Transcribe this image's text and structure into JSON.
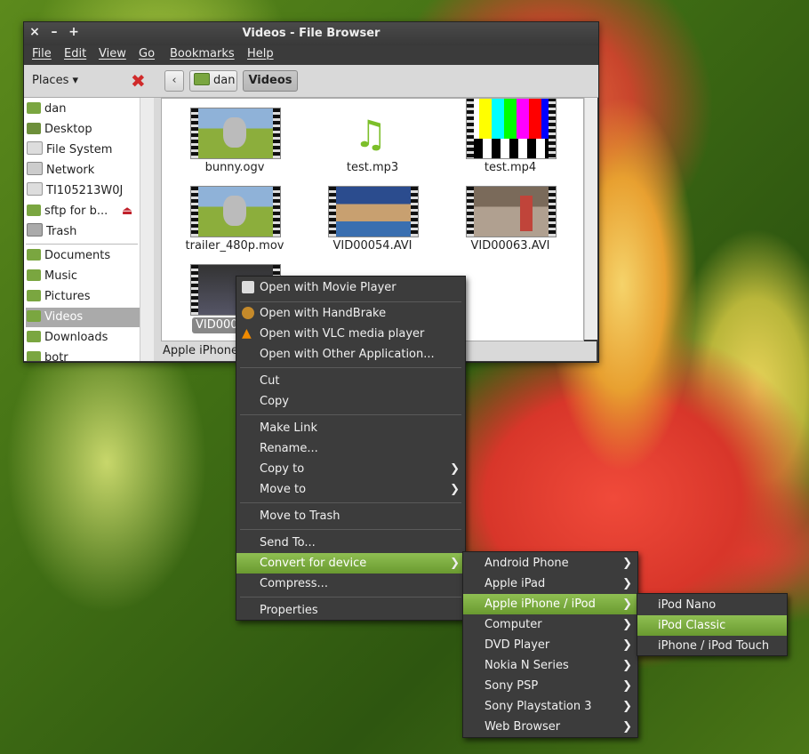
{
  "window": {
    "title": "Videos - File Browser",
    "controls": {
      "close": "×",
      "minimize": "–",
      "maximize": "+"
    }
  },
  "menubar": {
    "items": [
      "File",
      "Edit",
      "View",
      "Go",
      "Bookmarks",
      "Help"
    ]
  },
  "toolbar": {
    "places_label": "Places",
    "back": "‹",
    "breadcrumbs": [
      "dan",
      "Videos"
    ]
  },
  "sidebar": {
    "items": [
      "dan",
      "Desktop",
      "File System",
      "Network",
      "TI105213W0J",
      "sftp for b...",
      "Trash"
    ],
    "bookmarks": [
      "Documents",
      "Music",
      "Pictures",
      "Videos",
      "Downloads",
      "botr"
    ],
    "selected": "Videos",
    "eject_icon": "eject-icon"
  },
  "files": [
    {
      "name": "bunny.ogv",
      "kind": "video"
    },
    {
      "name": "test.mp3",
      "kind": "audio"
    },
    {
      "name": "test.mp4",
      "kind": "video"
    },
    {
      "name": "trailer_480p.mov",
      "kind": "video"
    },
    {
      "name": "VID00054.AVI",
      "kind": "video"
    },
    {
      "name": "VID00063.AVI",
      "kind": "video"
    },
    {
      "name": "VID000",
      "kind": "video",
      "selected": true
    }
  ],
  "statusbar": {
    "text": "Apple iPhone"
  },
  "context_menu": {
    "items": [
      {
        "label": "Open with Movie Player"
      },
      {
        "label": "Open with HandBrake"
      },
      {
        "label": "Open with VLC media player"
      },
      {
        "label": "Open with Other Application..."
      },
      {
        "label": "Cut"
      },
      {
        "label": "Copy"
      },
      {
        "label": "Make Link"
      },
      {
        "label": "Rename..."
      },
      {
        "label": "Copy to"
      },
      {
        "label": "Move to"
      },
      {
        "label": "Move to Trash"
      },
      {
        "label": "Send To..."
      },
      {
        "label": "Convert for device"
      },
      {
        "label": "Compress..."
      },
      {
        "label": "Properties"
      }
    ]
  },
  "device_menu": {
    "items": [
      "Android Phone",
      "Apple iPad",
      "Apple iPhone / iPod",
      "Computer",
      "DVD Player",
      "Nokia N Series",
      "Sony PSP",
      "Sony Playstation 3",
      "Web Browser"
    ],
    "highlighted": "Apple iPhone / iPod"
  },
  "ipod_menu": {
    "items": [
      "iPod Nano",
      "iPod Classic",
      "iPhone / iPod Touch"
    ],
    "highlighted": "iPod Classic"
  },
  "colors": {
    "accent": "#7aad3e",
    "menu_bg": "#3c3c3c",
    "folder": "#7aa640"
  }
}
